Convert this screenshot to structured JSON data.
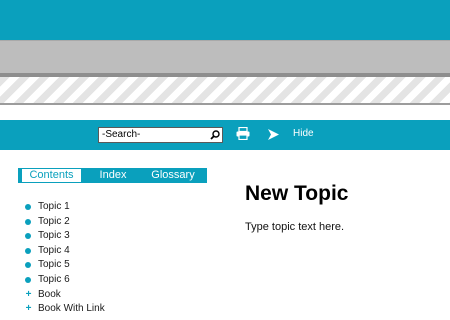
{
  "colors": {
    "accent": "#0aa0bd",
    "gray_band": "#bdbdbd",
    "stripe": "#e4e4e4"
  },
  "toolbar": {
    "search_value": "-Search-",
    "search_icon": "magnifier-icon",
    "print_icon": "printer-icon",
    "next_icon": "arrow-right-icon",
    "hide_label": "Hide"
  },
  "tabs": [
    {
      "label": "Contents",
      "active": true
    },
    {
      "label": "Index",
      "active": false
    },
    {
      "label": "Glossary",
      "active": false
    }
  ],
  "toc": [
    {
      "label": "Topic 1",
      "type": "topic"
    },
    {
      "label": "Topic 2",
      "type": "topic"
    },
    {
      "label": "Topic 3",
      "type": "topic"
    },
    {
      "label": "Topic 4",
      "type": "topic"
    },
    {
      "label": "Topic 5",
      "type": "topic"
    },
    {
      "label": "Topic 6",
      "type": "topic"
    },
    {
      "label": "Book",
      "type": "book"
    },
    {
      "label": "Book With Link",
      "type": "book"
    }
  ],
  "content": {
    "title": "New Topic",
    "body": "Type topic text here."
  }
}
